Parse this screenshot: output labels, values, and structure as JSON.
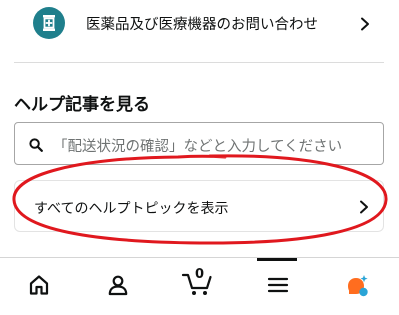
{
  "top_link": {
    "label": "医薬品及び医療機器のお問い合わせ",
    "icon": "medicine-icon"
  },
  "help_section": {
    "title": "ヘルプ記事を見る",
    "search": {
      "placeholder": "「配送状況の確認」などと入力してください",
      "icon": "search-icon"
    },
    "all_topics_label": "すべてのヘルプトピックを表示"
  },
  "annotation": {
    "shape": "ellipse",
    "color": "#e0181e"
  },
  "bottom_nav": {
    "items": [
      {
        "name": "home",
        "icon": "home-icon"
      },
      {
        "name": "account",
        "icon": "account-icon"
      },
      {
        "name": "cart",
        "icon": "cart-icon",
        "count": "0"
      },
      {
        "name": "menu",
        "icon": "menu-icon",
        "selected": true
      },
      {
        "name": "assistant",
        "icon": "assistant-icon"
      }
    ]
  },
  "colors": {
    "accent_teal": "#1f7f8c",
    "assistant_orange": "#ff6d1f",
    "assistant_blue": "#2aa4d6",
    "text": "#0f1111"
  }
}
